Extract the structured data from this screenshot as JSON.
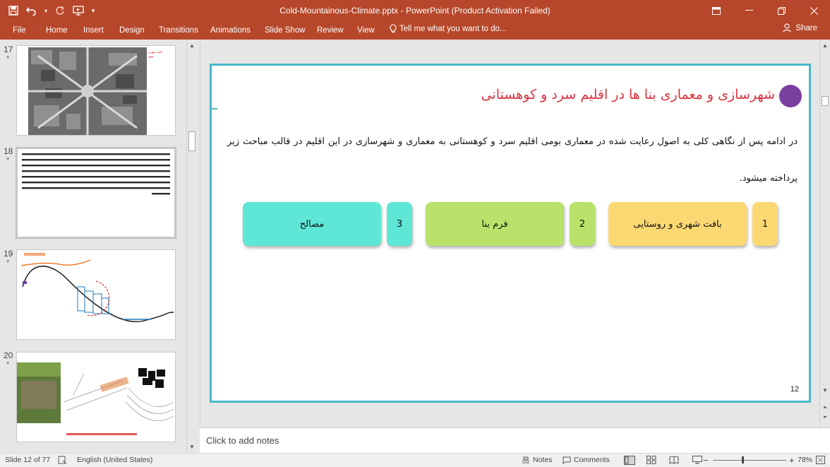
{
  "window": {
    "title": "Cold-Mountainous-Climate.pptx - PowerPoint (Product Activation Failed)"
  },
  "ribbon": {
    "tabs": [
      "File",
      "Home",
      "Insert",
      "Design",
      "Transitions",
      "Animations",
      "Slide Show",
      "Review",
      "View"
    ],
    "tell_me": "Tell me what you want to do...",
    "share": "Share"
  },
  "thumbnails": [
    {
      "number": "17",
      "star": "*"
    },
    {
      "number": "18",
      "star": "*"
    },
    {
      "number": "19",
      "star": "*"
    },
    {
      "number": "20",
      "star": "*"
    }
  ],
  "slide": {
    "title": "شهرسازی و معماری بنا ها در اقلیم سرد و کوهستانی",
    "body": "در ادامه پس از نگاهی کلی به اصول رعایت شده در معماری بومی اقلیم سرد و کوهستانی به معماری و شهرسازی در این اقلیم در قالب مباحث زیر پرداخته میشود.",
    "boxes": [
      {
        "label": "1",
        "color": "#fcd873"
      },
      {
        "label": "بافت شهری و روستایی",
        "color": "#fcd873"
      },
      {
        "label": "2",
        "color": "#b8e26a"
      },
      {
        "label": "فرم بنا",
        "color": "#b8e26a"
      },
      {
        "label": "3",
        "color": "#5ee6d6"
      },
      {
        "label": "مصالح",
        "color": "#5ee6d6"
      }
    ],
    "number": "12"
  },
  "notes": {
    "placeholder": "Click to add notes"
  },
  "status": {
    "slide_info": "Slide 12 of 77",
    "language": "English (United States)",
    "notes": "Notes",
    "comments": "Comments",
    "zoom": "78%"
  },
  "colors": {
    "accent": "#b7472a",
    "slide_border": "#4ab8c8",
    "title": "#d9333f",
    "title_dot": "#7b3fa0"
  }
}
